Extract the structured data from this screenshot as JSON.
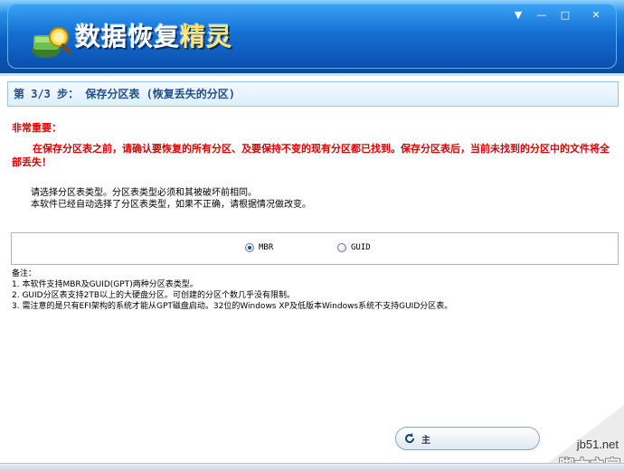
{
  "window": {
    "title": "数据恢复",
    "title_accent": "精灵",
    "controls": {
      "dropdown": "▼",
      "minimize": "—",
      "maximize": "□",
      "close": "✕"
    }
  },
  "step": {
    "heading": "第 3/3 步： 保存分区表 (恢复丢失的分区)"
  },
  "important": {
    "title": "非常重要：",
    "text": "在保存分区表之前，请确认要恢复的所有分区、及要保持不变的现有分区都已找到。保存分区表后，当前未找到的分区中的文件将全部丢失！"
  },
  "instructions": {
    "line1": "请选择分区表类型。分区表类型必须和其被破坏前相同。",
    "line2": "本软件已经自动选择了分区表类型，如果不正确，请根据情况做改变。"
  },
  "partition_type": {
    "options": [
      {
        "label": "MBR",
        "selected": true
      },
      {
        "label": "GUID",
        "selected": false
      }
    ]
  },
  "notes": {
    "title": "备注：",
    "items": [
      "1. 本软件支持MBR及GUID(GPT)两种分区表类型。",
      "2. GUID分区表支持2TB以上的大硬盘分区。可创建的分区个数几乎没有限制。",
      "3. 需注意的是只有EFI架构的系统才能从GPT磁盘启动。32位的Windows XP及低版本Windows系统不支持GUID分区表。"
    ]
  },
  "bottom": {
    "main_button_label": "主"
  },
  "watermark": {
    "top": "jb51.net",
    "bottom": "脚本之家"
  },
  "colors": {
    "header": "#0d5fc4",
    "warning": "#e00000",
    "heading_text": "#1d4f8f"
  }
}
